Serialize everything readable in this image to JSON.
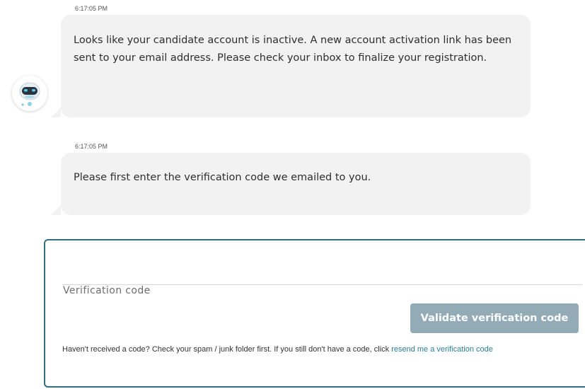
{
  "chat": {
    "messages": [
      {
        "timestamp": "6:17:05 PM",
        "text": "Looks like your candidate account is inactive. A new account activation link has been sent to your email address. Please check your inbox to finalize your registration."
      },
      {
        "timestamp": "6:17:05 PM",
        "text": "Please first enter the verification code we emailed to you."
      }
    ],
    "avatar_icon": "robot-icon"
  },
  "verification": {
    "input_value": "",
    "label": "Verification code",
    "validate_button": "Validate verification code",
    "help_text": "Haven't received a code? Check your spam / junk folder first. If you still don't have a code, click ",
    "resend_link": "resend me a verification code",
    "accent_color": "#2f6f7e",
    "button_color": "#92abb7",
    "link_color": "#2a7f98"
  }
}
